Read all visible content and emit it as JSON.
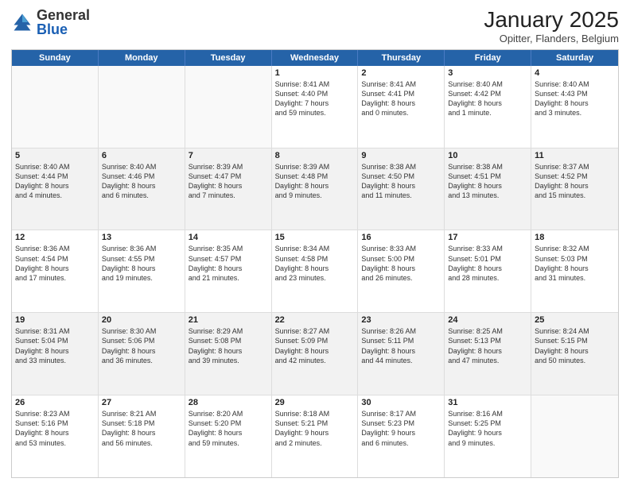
{
  "header": {
    "logo": {
      "general": "General",
      "blue": "Blue"
    },
    "title": "January 2025",
    "location": "Opitter, Flanders, Belgium"
  },
  "weekdays": [
    "Sunday",
    "Monday",
    "Tuesday",
    "Wednesday",
    "Thursday",
    "Friday",
    "Saturday"
  ],
  "rows": [
    {
      "alt": false,
      "cells": [
        {
          "day": "",
          "lines": []
        },
        {
          "day": "",
          "lines": []
        },
        {
          "day": "",
          "lines": []
        },
        {
          "day": "1",
          "lines": [
            "Sunrise: 8:41 AM",
            "Sunset: 4:40 PM",
            "Daylight: 7 hours",
            "and 59 minutes."
          ]
        },
        {
          "day": "2",
          "lines": [
            "Sunrise: 8:41 AM",
            "Sunset: 4:41 PM",
            "Daylight: 8 hours",
            "and 0 minutes."
          ]
        },
        {
          "day": "3",
          "lines": [
            "Sunrise: 8:40 AM",
            "Sunset: 4:42 PM",
            "Daylight: 8 hours",
            "and 1 minute."
          ]
        },
        {
          "day": "4",
          "lines": [
            "Sunrise: 8:40 AM",
            "Sunset: 4:43 PM",
            "Daylight: 8 hours",
            "and 3 minutes."
          ]
        }
      ]
    },
    {
      "alt": true,
      "cells": [
        {
          "day": "5",
          "lines": [
            "Sunrise: 8:40 AM",
            "Sunset: 4:44 PM",
            "Daylight: 8 hours",
            "and 4 minutes."
          ]
        },
        {
          "day": "6",
          "lines": [
            "Sunrise: 8:40 AM",
            "Sunset: 4:46 PM",
            "Daylight: 8 hours",
            "and 6 minutes."
          ]
        },
        {
          "day": "7",
          "lines": [
            "Sunrise: 8:39 AM",
            "Sunset: 4:47 PM",
            "Daylight: 8 hours",
            "and 7 minutes."
          ]
        },
        {
          "day": "8",
          "lines": [
            "Sunrise: 8:39 AM",
            "Sunset: 4:48 PM",
            "Daylight: 8 hours",
            "and 9 minutes."
          ]
        },
        {
          "day": "9",
          "lines": [
            "Sunrise: 8:38 AM",
            "Sunset: 4:50 PM",
            "Daylight: 8 hours",
            "and 11 minutes."
          ]
        },
        {
          "day": "10",
          "lines": [
            "Sunrise: 8:38 AM",
            "Sunset: 4:51 PM",
            "Daylight: 8 hours",
            "and 13 minutes."
          ]
        },
        {
          "day": "11",
          "lines": [
            "Sunrise: 8:37 AM",
            "Sunset: 4:52 PM",
            "Daylight: 8 hours",
            "and 15 minutes."
          ]
        }
      ]
    },
    {
      "alt": false,
      "cells": [
        {
          "day": "12",
          "lines": [
            "Sunrise: 8:36 AM",
            "Sunset: 4:54 PM",
            "Daylight: 8 hours",
            "and 17 minutes."
          ]
        },
        {
          "day": "13",
          "lines": [
            "Sunrise: 8:36 AM",
            "Sunset: 4:55 PM",
            "Daylight: 8 hours",
            "and 19 minutes."
          ]
        },
        {
          "day": "14",
          "lines": [
            "Sunrise: 8:35 AM",
            "Sunset: 4:57 PM",
            "Daylight: 8 hours",
            "and 21 minutes."
          ]
        },
        {
          "day": "15",
          "lines": [
            "Sunrise: 8:34 AM",
            "Sunset: 4:58 PM",
            "Daylight: 8 hours",
            "and 23 minutes."
          ]
        },
        {
          "day": "16",
          "lines": [
            "Sunrise: 8:33 AM",
            "Sunset: 5:00 PM",
            "Daylight: 8 hours",
            "and 26 minutes."
          ]
        },
        {
          "day": "17",
          "lines": [
            "Sunrise: 8:33 AM",
            "Sunset: 5:01 PM",
            "Daylight: 8 hours",
            "and 28 minutes."
          ]
        },
        {
          "day": "18",
          "lines": [
            "Sunrise: 8:32 AM",
            "Sunset: 5:03 PM",
            "Daylight: 8 hours",
            "and 31 minutes."
          ]
        }
      ]
    },
    {
      "alt": true,
      "cells": [
        {
          "day": "19",
          "lines": [
            "Sunrise: 8:31 AM",
            "Sunset: 5:04 PM",
            "Daylight: 8 hours",
            "and 33 minutes."
          ]
        },
        {
          "day": "20",
          "lines": [
            "Sunrise: 8:30 AM",
            "Sunset: 5:06 PM",
            "Daylight: 8 hours",
            "and 36 minutes."
          ]
        },
        {
          "day": "21",
          "lines": [
            "Sunrise: 8:29 AM",
            "Sunset: 5:08 PM",
            "Daylight: 8 hours",
            "and 39 minutes."
          ]
        },
        {
          "day": "22",
          "lines": [
            "Sunrise: 8:27 AM",
            "Sunset: 5:09 PM",
            "Daylight: 8 hours",
            "and 42 minutes."
          ]
        },
        {
          "day": "23",
          "lines": [
            "Sunrise: 8:26 AM",
            "Sunset: 5:11 PM",
            "Daylight: 8 hours",
            "and 44 minutes."
          ]
        },
        {
          "day": "24",
          "lines": [
            "Sunrise: 8:25 AM",
            "Sunset: 5:13 PM",
            "Daylight: 8 hours",
            "and 47 minutes."
          ]
        },
        {
          "day": "25",
          "lines": [
            "Sunrise: 8:24 AM",
            "Sunset: 5:15 PM",
            "Daylight: 8 hours",
            "and 50 minutes."
          ]
        }
      ]
    },
    {
      "alt": false,
      "cells": [
        {
          "day": "26",
          "lines": [
            "Sunrise: 8:23 AM",
            "Sunset: 5:16 PM",
            "Daylight: 8 hours",
            "and 53 minutes."
          ]
        },
        {
          "day": "27",
          "lines": [
            "Sunrise: 8:21 AM",
            "Sunset: 5:18 PM",
            "Daylight: 8 hours",
            "and 56 minutes."
          ]
        },
        {
          "day": "28",
          "lines": [
            "Sunrise: 8:20 AM",
            "Sunset: 5:20 PM",
            "Daylight: 8 hours",
            "and 59 minutes."
          ]
        },
        {
          "day": "29",
          "lines": [
            "Sunrise: 8:18 AM",
            "Sunset: 5:21 PM",
            "Daylight: 9 hours",
            "and 2 minutes."
          ]
        },
        {
          "day": "30",
          "lines": [
            "Sunrise: 8:17 AM",
            "Sunset: 5:23 PM",
            "Daylight: 9 hours",
            "and 6 minutes."
          ]
        },
        {
          "day": "31",
          "lines": [
            "Sunrise: 8:16 AM",
            "Sunset: 5:25 PM",
            "Daylight: 9 hours",
            "and 9 minutes."
          ]
        },
        {
          "day": "",
          "lines": []
        }
      ]
    }
  ]
}
